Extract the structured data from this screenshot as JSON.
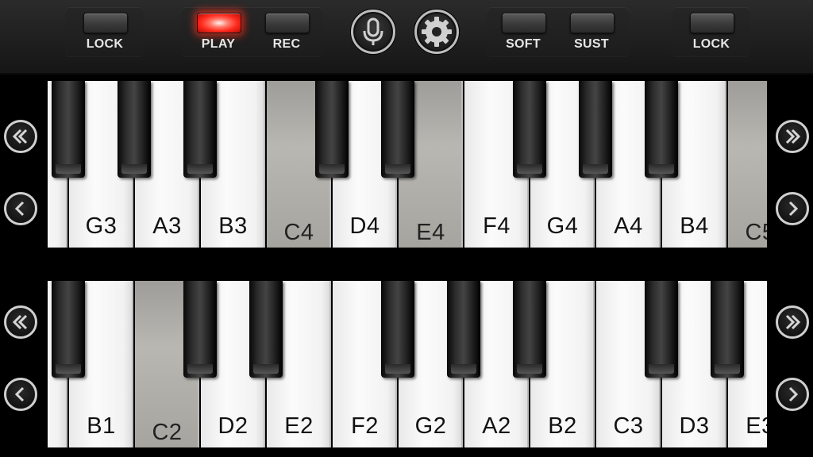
{
  "toolbar": {
    "lock_left_label": "LOCK",
    "play_label": "PLAY",
    "rec_label": "REC",
    "soft_label": "SOFT",
    "sust_label": "SUST",
    "lock_right_label": "LOCK",
    "play_active": true,
    "play_light_color": "#ff2a1e",
    "microphone_icon": "microphone-icon",
    "settings_icon": "gear-icon"
  },
  "keyboard_upper": {
    "white_keys": [
      {
        "note": "G3"
      },
      {
        "note": "A3"
      },
      {
        "note": "B3"
      },
      {
        "note": "C4",
        "pressed": true
      },
      {
        "note": "D4"
      },
      {
        "note": "E4",
        "pressed": true
      },
      {
        "note": "F4"
      },
      {
        "note": "G4"
      },
      {
        "note": "A4"
      },
      {
        "note": "B4"
      },
      {
        "note": "C5",
        "pressed": true
      }
    ]
  },
  "keyboard_lower": {
    "white_keys": [
      {
        "note": "B1"
      },
      {
        "note": "C2",
        "pressed": true
      },
      {
        "note": "D2"
      },
      {
        "note": "E2"
      },
      {
        "note": "F2"
      },
      {
        "note": "G2"
      },
      {
        "note": "A2"
      },
      {
        "note": "B2"
      },
      {
        "note": "C3"
      },
      {
        "note": "D3"
      },
      {
        "note": "E3"
      }
    ]
  },
  "navigation": {
    "fast_left_icon": "double-chevron-left-icon",
    "left_icon": "chevron-left-icon",
    "fast_right_icon": "double-chevron-right-icon",
    "right_icon": "chevron-right-icon"
  }
}
